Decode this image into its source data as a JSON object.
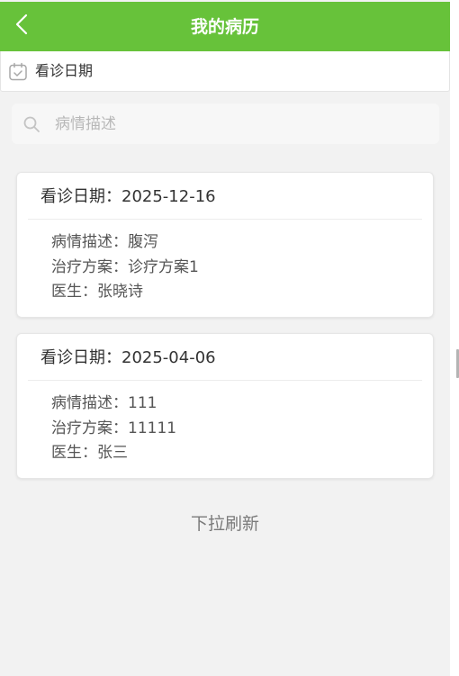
{
  "header": {
    "title": "我的病历",
    "back_icon": "chevron-left-icon",
    "background": "#67c23a"
  },
  "date_filter": {
    "label": "看诊日期",
    "icon": "calendar-check-icon"
  },
  "search": {
    "placeholder": "病情描述",
    "value": "",
    "icon": "search-icon"
  },
  "records": [
    {
      "date_label": "看诊日期：",
      "date": "2025-12-16",
      "condition_label": "病情描述：",
      "condition": "腹泻",
      "treatment_label": "治疗方案：",
      "treatment": "诊疗方案1",
      "doctor_label": "医生：",
      "doctor": "张晓诗"
    },
    {
      "date_label": "看诊日期：",
      "date": "2025-04-06",
      "condition_label": "病情描述：",
      "condition": "111",
      "treatment_label": "治疗方案：",
      "treatment": "11111",
      "doctor_label": "医生：",
      "doctor": "张三"
    }
  ],
  "footer": {
    "refresh_hint": "下拉刷新"
  }
}
